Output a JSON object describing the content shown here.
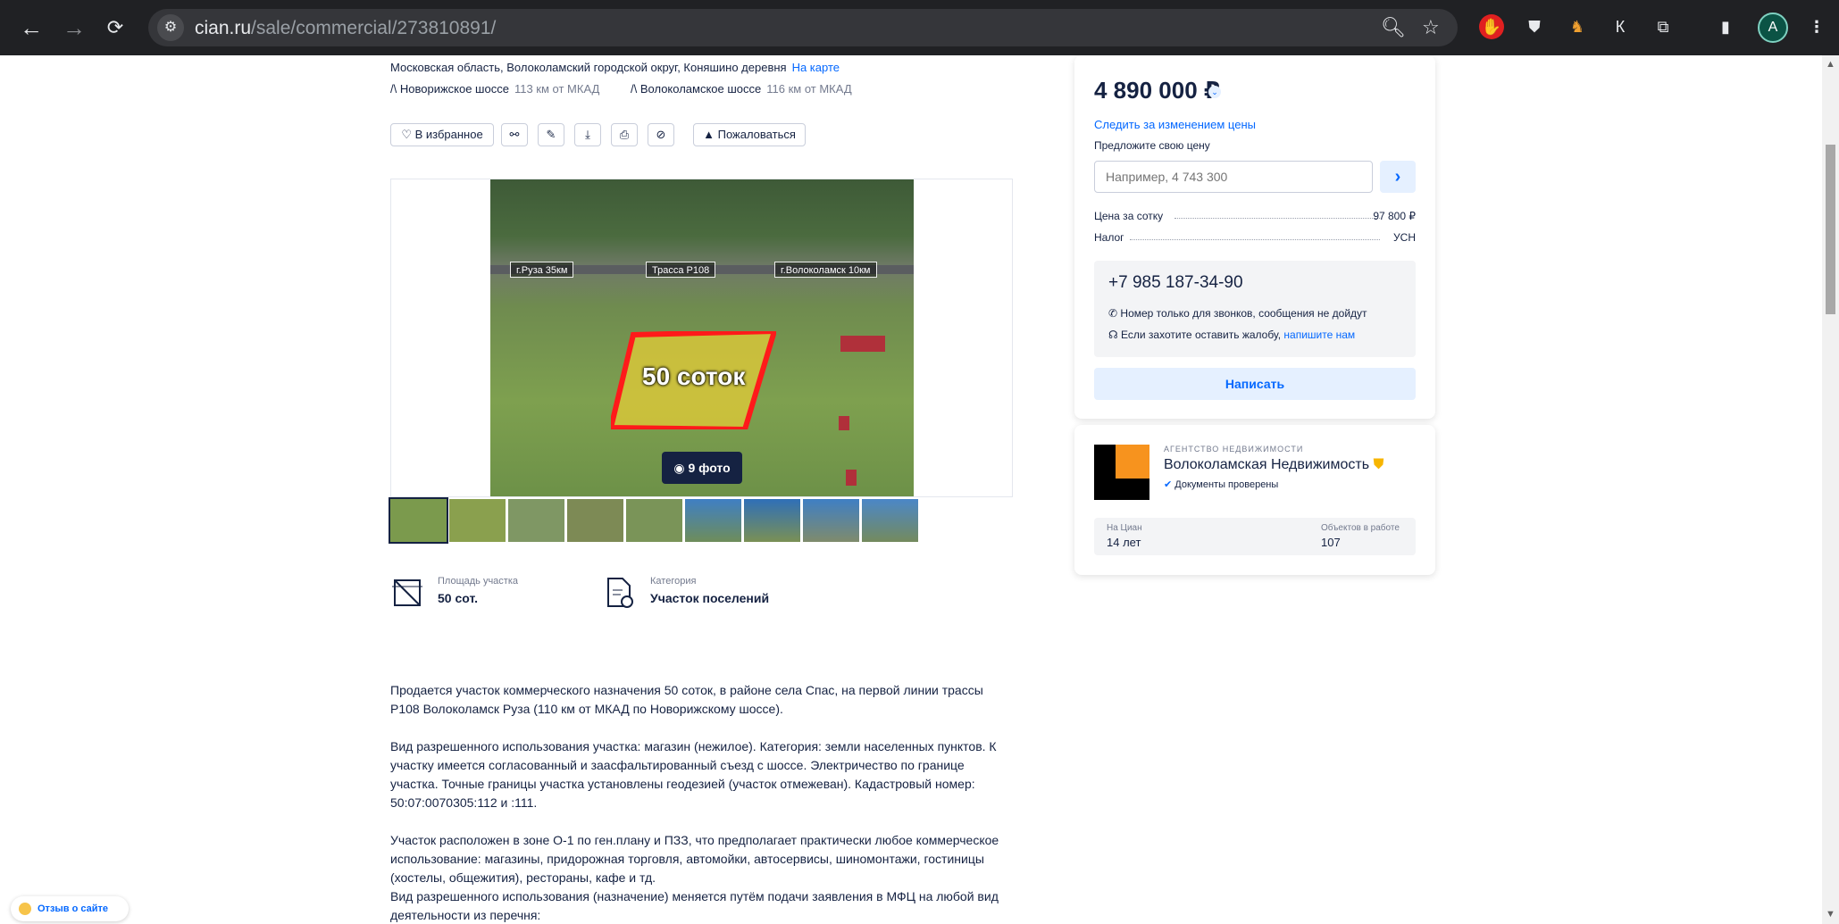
{
  "browser": {
    "url_domain": "cian.ru",
    "url_path": "/sale/commercial/273810891/",
    "ext_k_label": "К",
    "avatar_letter": "A"
  },
  "listing": {
    "address": "Московская область, Волоколамский городской округ, Коняшино деревня",
    "map_link": "На карте",
    "highways": [
      {
        "name": "Новорижское шоссе",
        "distance": "113 км от МКАД"
      },
      {
        "name": "Волоколамское шоссе",
        "distance": "116 км от МКАД"
      }
    ],
    "actions": {
      "favorite": "В избранное",
      "complain": "Пожаловаться"
    },
    "photo": {
      "count_label": "9 фото",
      "plot_label": "50 соток",
      "tag_left": "г.Руза 35км",
      "tag_mid": "Трасса Р108",
      "tag_right": "г.Волоколамск 10км"
    },
    "features": [
      {
        "label": "Площадь участка",
        "value": "50 сот."
      },
      {
        "label": "Категория",
        "value": "Участок поселений"
      }
    ],
    "description": [
      "Продается участок коммерческого назначения 50 соток, в районе села Спас, на первой линии трассы Р108 Волоколамск  Руза (110 км от МКАД по Новорижскому шоссе).",
      "Вид разрешенного использования участка: магазин (нежилое). Категория: земли населенных пунктов. К участку имеется согласованный и заасфальтированный съезд с шоссе. Электричество по границе участка. Точные границы участка установлены геодезией (участок отмежеван). Кадастровый номер: 50:07:0070305:112 и :111.",
      "Участок расположен в зоне О-1 по ген.плану и ПЗЗ, что предполагает практически любое коммерческое использование: магазины, придорожная торговля, автомойки, автосервисы, шиномонтажи, гостиницы (хостелы, общежития), рестораны, кафе и тд.",
      "Вид разрешенного использования (назначение) меняется путём подачи заявления в МФЦ на любой вид деятельности из перечня:"
    ]
  },
  "sidebar": {
    "price": "4 890 000 ₽",
    "follow_price": "Следить за изменением цены",
    "offer_label": "Предложите свою цену",
    "offer_placeholder": "Например, 4 743 300",
    "price_per_sotka_label": "Цена за сотку",
    "price_per_sotka_value": "97 800 ₽",
    "tax_label": "Налог",
    "tax_value": "УСН",
    "phone": "+7 985 187-34-90",
    "phone_note": "Номер только для звонков, сообщения не дойдут",
    "complaint_note": "Если захотите оставить жалобу,",
    "complaint_link": "напишите нам",
    "write_button": "Написать"
  },
  "agency": {
    "caption": "АГЕНТСТВО НЕДВИЖИМОСТИ",
    "name": "Волоколамская Недвижимость",
    "verified": "Документы проверены",
    "years_label": "На Циан",
    "years_value": "14 лет",
    "objects_label": "Объектов в работе",
    "objects_value": "107"
  },
  "feedback_widget": "Отзыв о сайте"
}
